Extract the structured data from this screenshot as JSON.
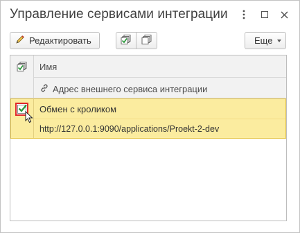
{
  "window": {
    "title": "Управление сервисами интеграции",
    "controls": [
      "more-vertical-icon",
      "maximize-icon",
      "close-icon"
    ]
  },
  "toolbar": {
    "edit_label": "Редактировать",
    "edit_icon": "pencil-icon",
    "check_all_icon": "check-all-icon",
    "uncheck_all_icon": "uncheck-all-icon",
    "more_label": "Еще"
  },
  "table": {
    "columns": {
      "name_header": "Имя",
      "url_header": "Адрес внешнего сервиса интеграции"
    },
    "rows": [
      {
        "checked": true,
        "selected": true,
        "name": "Обмен с кроликом",
        "url": "http://127.0.0.1:9090/applications/Proekt-2-dev"
      }
    ]
  },
  "colors": {
    "selected_row": "#fbec9f",
    "selected_border": "#e6c64c",
    "checkbox_focus": "#e0282a",
    "check_green": "#2e9a3e"
  }
}
